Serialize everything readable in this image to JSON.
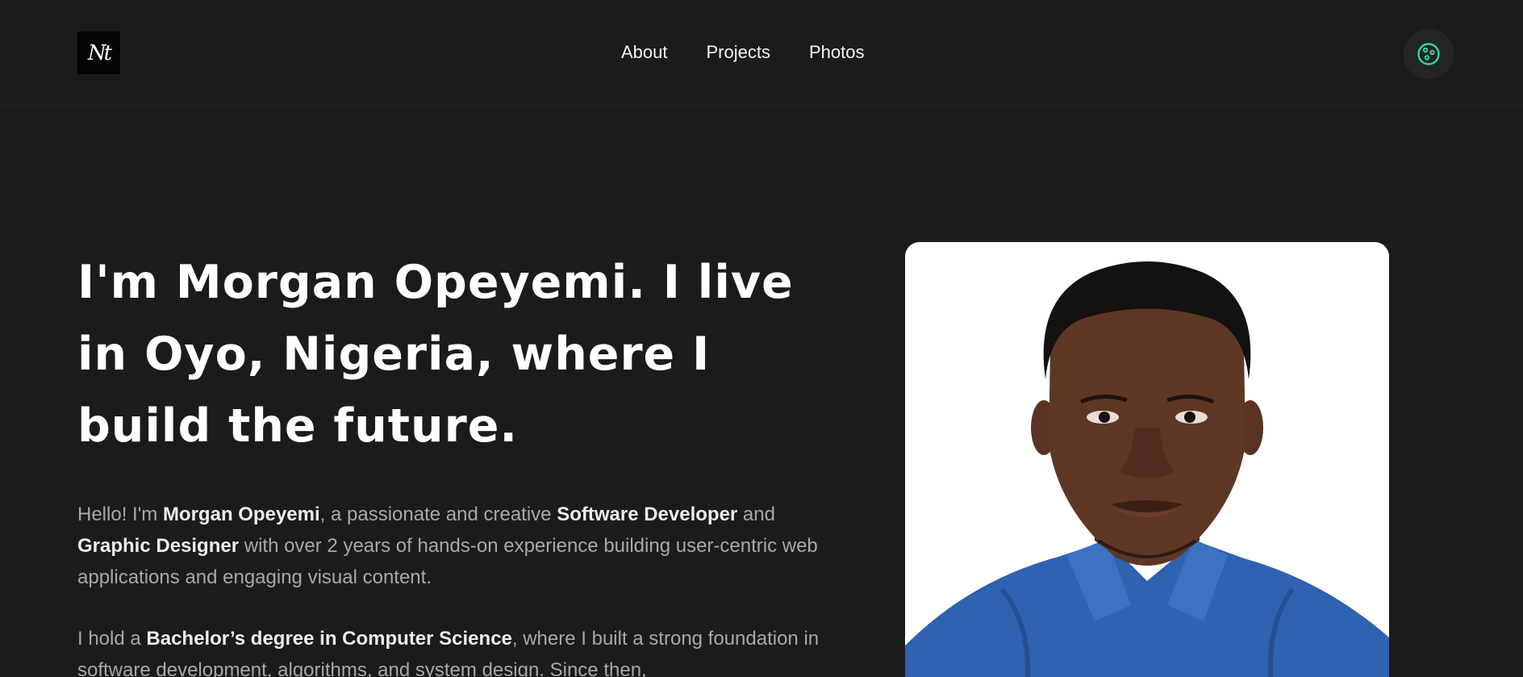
{
  "header": {
    "logo_text": "Nt",
    "nav": [
      {
        "label": "About"
      },
      {
        "label": "Projects"
      },
      {
        "label": "Photos"
      }
    ],
    "theme_icon": "palette-icon",
    "accent_color": "#34d399"
  },
  "hero": {
    "title": "I'm Morgan Opeyemi. I live in Oyo, Nigeria, where I build the future.",
    "p1": {
      "t1": "Hello! I'm ",
      "b1": "Morgan Opeyemi",
      "t2": ", a passionate and creative ",
      "b2": "Software Developer",
      "t3": " and ",
      "b3": "Graphic Designer",
      "t4": " with over 2 years of hands-on experience building user-centric web applications and engaging visual content."
    },
    "p2": {
      "t1": "I hold a ",
      "b1": "Bachelor’s degree in Computer Science",
      "t2": ", where I built a strong foundation in software development, algorithms, and system design. Since then,"
    },
    "photo": "portrait-photo"
  }
}
